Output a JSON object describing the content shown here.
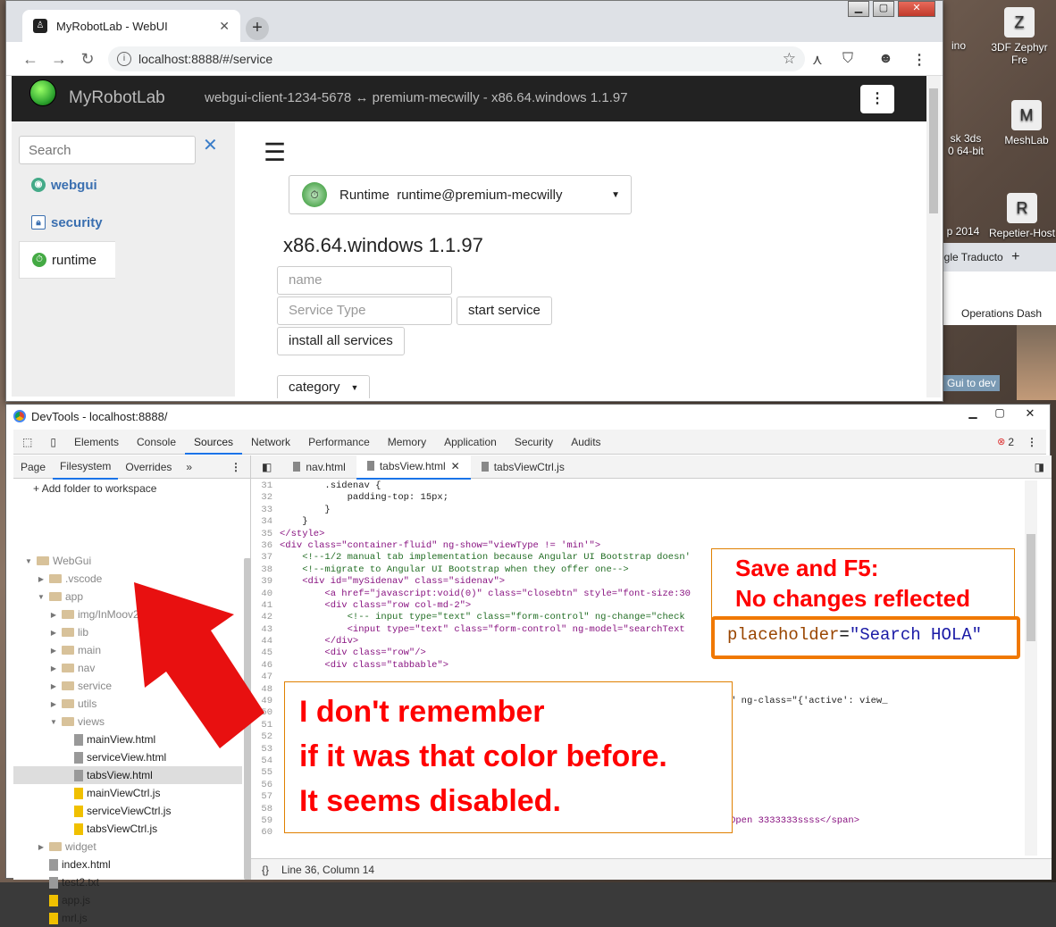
{
  "desktop": {
    "icons": [
      {
        "label": "ino"
      },
      {
        "label": "3DF Zephyr Fre"
      },
      {
        "label": "sk 3ds\n0 64-bit"
      },
      {
        "label": "MeshLab"
      },
      {
        "label": "p 2014"
      },
      {
        "label": "Repetier-Host"
      },
      {
        "label": "ogle Traducto"
      },
      {
        "label": "Operations Dash"
      },
      {
        "label": "Gui to dev"
      }
    ]
  },
  "browser": {
    "tab_title": "MyRobotLab - WebUI",
    "url": "localhost:8888/#/service",
    "new_tab": "+",
    "tab_close": "✕"
  },
  "app": {
    "title": "MyRobotLab",
    "subtitle": "webgui-client-1234-5678 ↔ premium-mecwilly - x86.64.windows 1.1.97",
    "menu": "⋮",
    "search_placeholder": "Search",
    "search_close": "✕",
    "nav": [
      {
        "label": "webgui"
      },
      {
        "label": "security"
      },
      {
        "label": "runtime"
      }
    ],
    "runtime_label": "Runtime",
    "runtime_name": "runtime@premium-mecwilly",
    "platform": "x86.64.windows 1.1.97",
    "name_placeholder": "name",
    "service_type_placeholder": "Service Type",
    "start_service": "start service",
    "install_all": "install all services",
    "category": "category"
  },
  "devtools": {
    "title": "DevTools - localhost:8888/",
    "tabs": [
      "Elements",
      "Console",
      "Sources",
      "Network",
      "Performance",
      "Memory",
      "Application",
      "Security",
      "Audits"
    ],
    "active_tab": "Sources",
    "error_count": "2",
    "left_tabs": [
      "Page",
      "Filesystem",
      "Overrides",
      "»"
    ],
    "add_folder": "Add folder to workspace",
    "tree": [
      {
        "label": "WebGui",
        "kind": "folder",
        "indent": 0,
        "open": true
      },
      {
        "label": ".vscode",
        "kind": "folder",
        "indent": 1
      },
      {
        "label": "app",
        "kind": "folder",
        "indent": 1,
        "open": true
      },
      {
        "label": "img/InMoov2",
        "kind": "folder",
        "indent": 2
      },
      {
        "label": "lib",
        "kind": "folder",
        "indent": 2
      },
      {
        "label": "main",
        "kind": "folder",
        "indent": 2
      },
      {
        "label": "nav",
        "kind": "folder",
        "indent": 2
      },
      {
        "label": "service",
        "kind": "folder",
        "indent": 2
      },
      {
        "label": "utils",
        "kind": "folder",
        "indent": 2
      },
      {
        "label": "views",
        "kind": "folder",
        "indent": 2,
        "open": true
      },
      {
        "label": "mainView.html",
        "kind": "file",
        "indent": 3
      },
      {
        "label": "serviceView.html",
        "kind": "file",
        "indent": 3
      },
      {
        "label": "tabsView.html",
        "kind": "file",
        "indent": 3,
        "selected": true
      },
      {
        "label": "mainViewCtrl.js",
        "kind": "js",
        "indent": 3
      },
      {
        "label": "serviceViewCtrl.js",
        "kind": "js",
        "indent": 3
      },
      {
        "label": "tabsViewCtrl.js",
        "kind": "js",
        "indent": 3
      },
      {
        "label": "widget",
        "kind": "folder",
        "indent": 1
      },
      {
        "label": "index.html",
        "kind": "file",
        "indent": 1
      },
      {
        "label": "test2.txt",
        "kind": "file",
        "indent": 1
      },
      {
        "label": "app.js",
        "kind": "js",
        "indent": 1
      },
      {
        "label": "mrl.js",
        "kind": "js",
        "indent": 1
      }
    ],
    "editor_tabs": [
      "nav.html",
      "tabsView.html",
      "tabsViewCtrl.js"
    ],
    "active_editor_tab": "tabsView.html",
    "code": [
      {
        "n": "31",
        "t": "        .sidenav {"
      },
      {
        "n": "32",
        "t": "            padding-top: 15px;"
      },
      {
        "n": "33",
        "t": "        }"
      },
      {
        "n": "34",
        "t": "    }"
      },
      {
        "n": "35",
        "t": "</style>"
      },
      {
        "n": "36",
        "t": "<div class=\"container-fluid\" ng-show=\"viewType != 'min'\">"
      },
      {
        "n": "37",
        "t": "    <!--1/2 manual tab implementation because Angular UI Bootstrap doesn'"
      },
      {
        "n": "38",
        "t": "    <!--migrate to Angular UI Bootstrap when they offer one-->"
      },
      {
        "n": "39",
        "t": "    <div id=\"mySidenav\" class=\"sidenav\">"
      },
      {
        "n": "40",
        "t": "        <a href=\"javascript:void(0)\" class=\"closebtn\" style=\"font-size:30"
      },
      {
        "n": "41",
        "t": "        <div class=\"row col-md-2\">"
      },
      {
        "n": "42",
        "t": "            <!-- input type=\"text\" class=\"form-control\" ng-change=\"check"
      },
      {
        "n": "43",
        "t": "            <input type=\"text\" class=\"form-control\" ng-model=\"searchText"
      },
      {
        "n": "44",
        "t": "        </div>"
      },
      {
        "n": "45",
        "t": "        <div class=\"row\"/>"
      },
      {
        "n": "46",
        "t": "        <div class=\"tabbable\">"
      },
      {
        "n": "47",
        "t": ""
      },
      {
        "n": "48",
        "t": ""
      },
      {
        "n": "49",
        "t": "                                                        er:searchText:wildCardOn\" ng-class=\"{'active': view_"
      },
      {
        "n": "50",
        "t": "                                                        \" href=\"\">"
      },
      {
        "n": "51",
        "t": ""
      },
      {
        "n": "52",
        "t": ""
      },
      {
        "n": "53",
        "t": ""
      },
      {
        "n": "54",
        "t": ""
      },
      {
        "n": "55",
        "t": ""
      },
      {
        "n": "56",
        "t": ""
      },
      {
        "n": "57",
        "t": ""
      },
      {
        "n": "58",
        "t": ""
      },
      {
        "n": "59",
        "t": "    <span onmouseenter=\"openNav()\" style=\"font-size:30px;cursor:pointer\">&#9776;Open 3333333ssss</span>"
      },
      {
        "n": "60",
        "t": ""
      }
    ],
    "status": "Line 36, Column 14",
    "status_icon": "{}"
  },
  "annotations": {
    "note1_line1": "Save and F5:",
    "note1_line2": "No changes reflected",
    "note2_attr": "placeholder",
    "note2_eq": "=",
    "note2_value": "\"Search HOLA\"",
    "note3_line1": "I don't remember",
    "note3_line2": "if it was that color before.",
    "note3_line3": "It seems disabled.",
    "arrow_color": "#e81010"
  }
}
